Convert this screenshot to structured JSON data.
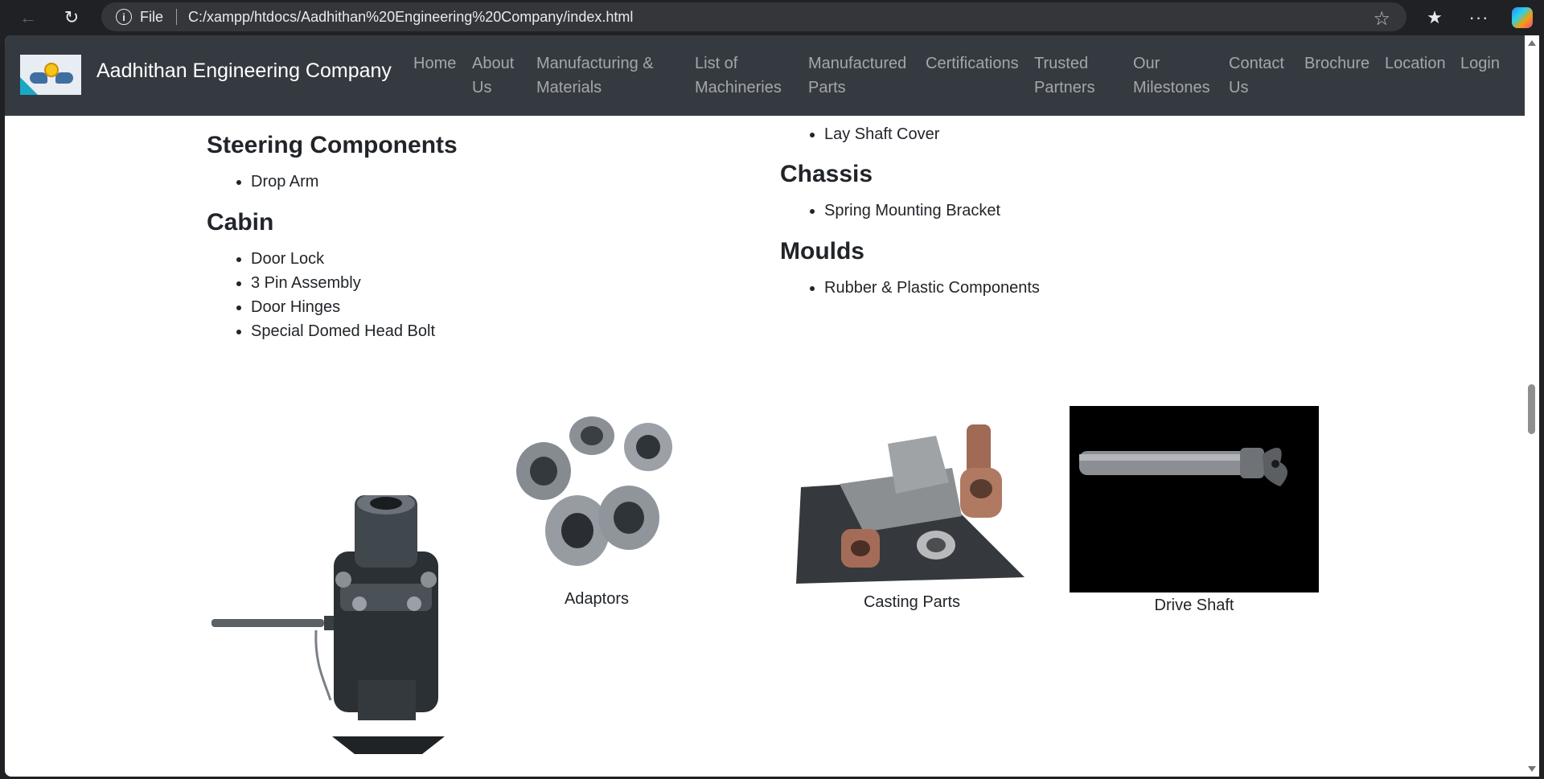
{
  "browser": {
    "site_info_label": "File",
    "url": "C:/xampp/htdocs/Aadhithan%20Engineering%20Company/index.html"
  },
  "navbar": {
    "brand": "Aadhithan Engineering Company",
    "items": [
      {
        "line1": "Home",
        "line2": ""
      },
      {
        "line1": "About",
        "line2": "Us"
      },
      {
        "line1": "Manufacturing &",
        "line2": "Materials"
      },
      {
        "line1": "List of",
        "line2": "Machineries"
      },
      {
        "line1": "Manufactured",
        "line2": "Parts"
      },
      {
        "line1": "Certifications",
        "line2": ""
      },
      {
        "line1": "Trusted",
        "line2": "Partners"
      },
      {
        "line1": "Our",
        "line2": "Milestones"
      },
      {
        "line1": "Contact",
        "line2": "Us"
      },
      {
        "line1": "Brochure",
        "line2": ""
      },
      {
        "line1": "Location",
        "line2": ""
      },
      {
        "line1": "Login",
        "line2": ""
      }
    ]
  },
  "left_column": {
    "sections": [
      {
        "title": "Steering Components",
        "items": [
          "Drop Arm"
        ]
      },
      {
        "title": "Cabin",
        "items": [
          "Door Lock",
          "3 Pin Assembly",
          "Door Hinges",
          "Special Domed Head Bolt"
        ]
      }
    ]
  },
  "right_column": {
    "partial_item": "Lay Shaft Cover",
    "sections": [
      {
        "title": "Chassis",
        "items": [
          "Spring Mounting Bracket"
        ]
      },
      {
        "title": "Moulds",
        "items": [
          "Rubber & Plastic Components"
        ]
      }
    ]
  },
  "gallery": {
    "captions": [
      "Adaptors",
      "Casting Parts",
      "Drive Shaft"
    ]
  },
  "colors": {
    "navbar_bg": "#343a40",
    "nav_link": "rgba(255,255,255,0.55)",
    "text": "#212529"
  }
}
